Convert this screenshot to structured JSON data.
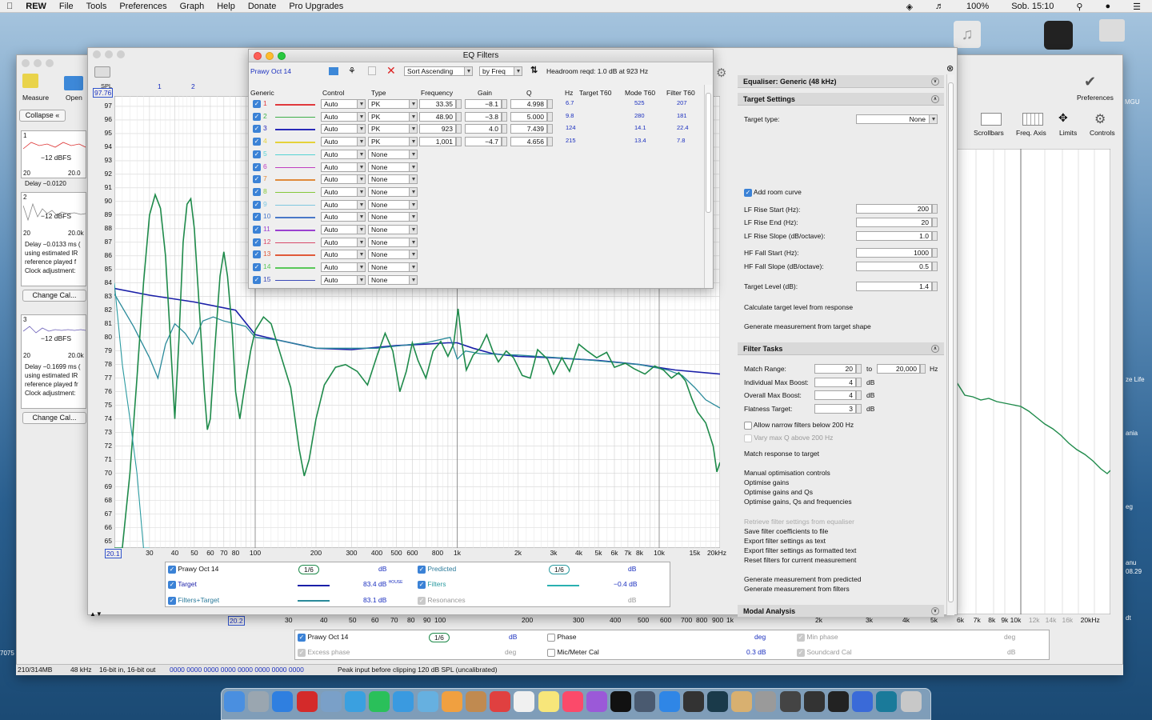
{
  "menubar": {
    "app": "REW",
    "items": [
      "File",
      "Tools",
      "Preferences",
      "Graph",
      "Help",
      "Donate",
      "Pro Upgrades"
    ],
    "battery": "100%",
    "clock": "Sob. 15:10"
  },
  "left_panel": {
    "tool_measure": "Measure",
    "tool_open": "Open",
    "collapse": "Collapse",
    "m1": {
      "num": "1",
      "level": "−12 dBFS",
      "x0": "20",
      "x1": "20.0",
      "delay": "Delay −0.0120"
    },
    "m2": {
      "num": "2",
      "level": "−12 dBFS",
      "x0": "20",
      "x1": "20.0k",
      "delay": "Delay −0.0133 ms (",
      "l2": "using estimated IR",
      "l3": "reference played f",
      "l4": "Clock adjustment:"
    },
    "m3": {
      "num": "3",
      "level": "−12 dBFS",
      "x0": "20",
      "x1": "20.0k",
      "delay": "Delay −0.1699 ms (",
      "l2": "using estimated IR",
      "l3": "reference played fr",
      "l4": "Clock adjustment:"
    },
    "change_cal": "Change Cal..."
  },
  "graph": {
    "y_unit": "SPL",
    "y_top": "97.76",
    "y_ticks": [
      "97",
      "96",
      "95",
      "94",
      "93",
      "92",
      "91",
      "90",
      "89",
      "88",
      "87",
      "86",
      "85",
      "84",
      "83",
      "82",
      "81",
      "80",
      "79",
      "78",
      "77",
      "76",
      "75",
      "74",
      "73",
      "72",
      "71",
      "70",
      "69",
      "68",
      "67",
      "66",
      "65"
    ],
    "x_start": "20.1",
    "x_ticks": [
      "30",
      "40",
      "50",
      "60",
      "70",
      "80",
      "100",
      "200",
      "300",
      "400",
      "500",
      "600",
      "800",
      "1k",
      "2k",
      "3k",
      "4k",
      "5k",
      "6k",
      "7k",
      "8k",
      "10k",
      "15k",
      "20kHz"
    ],
    "markers": [
      "1",
      "2"
    ]
  },
  "legend": {
    "r1": {
      "name": "Prawy Oct 14",
      "smooth": "1/6",
      "unit": "dB",
      "name2": "Predicted",
      "smooth2": "1/6",
      "unit2": "dB"
    },
    "r2": {
      "name": "Target",
      "val": "83.4 dB",
      "sup": "HOUSE",
      "name2": "Filters",
      "val2": "−0.4 dB"
    },
    "r3": {
      "name": "Filters+Target",
      "val": "83.1 dB",
      "name2": "Resonances",
      "unit2": "dB"
    }
  },
  "bottom_legend": {
    "name": "Prawy Oct 14",
    "smooth": "1/6",
    "unit": "dB",
    "phase": "Phase",
    "phase_unit": "deg",
    "min_phase": "Min phase",
    "min_unit": "deg",
    "excess": "Excess phase",
    "excess_unit": "deg",
    "mic": "Mic/Meter Cal",
    "mic_val": "0.3 dB",
    "sound": "Soundcard Cal",
    "sound_unit": "dB"
  },
  "bottom_axis": {
    "start": "20.2",
    "ticks": [
      "30",
      "40",
      "50",
      "60",
      "70",
      "80",
      "90",
      "100",
      "200",
      "300",
      "400",
      "500",
      "600",
      "700",
      "800",
      "900",
      "1k",
      "2k",
      "3k",
      "4k",
      "5k",
      "6k",
      "7k",
      "8k",
      "9k",
      "10k",
      "12k",
      "14k",
      "16k",
      "20kHz"
    ]
  },
  "status": {
    "mem": "210/314MB",
    "rate": "48 kHz",
    "bits": "16-bit in, 16-bit out",
    "meters": "0000 0000  0000 0000  0000 0000  0000 0000",
    "peak": "Peak input before clipping 120 dB SPL (uncalibrated)"
  },
  "eq_window": {
    "title": "EQ Filters",
    "measurement": "Prawy Oct 14",
    "sort": "Sort Ascending",
    "by": "by Freq",
    "headroom": "Headroom reqd:   1.0 dB at 923 Hz",
    "cols": {
      "generic": "Generic",
      "control": "Control",
      "type": "Type",
      "frequency": "Frequency",
      "gain": "Gain",
      "q": "Q",
      "hz": "Hz",
      "target_t60": "Target T60",
      "mode_t60": "Mode T60",
      "filter_t60": "Filter T60"
    },
    "filters": [
      {
        "n": "1",
        "color": "#e0393d",
        "control": "Auto",
        "type": "PK",
        "freq": "33.35",
        "gain": "−8.1",
        "q": "4.998"
      },
      {
        "n": "2",
        "color": "#3fb04a",
        "control": "Auto",
        "type": "PK",
        "freq": "48.90",
        "gain": "−3.8",
        "q": "5.000"
      },
      {
        "n": "3",
        "color": "#2a2ab8",
        "control": "Auto",
        "type": "PK",
        "freq": "923",
        "gain": "4.0",
        "q": "7.439"
      },
      {
        "n": "4",
        "color": "#e5d23a",
        "control": "Auto",
        "type": "PK",
        "freq": "1,001",
        "gain": "−4.7",
        "q": "4.656"
      },
      {
        "n": "5",
        "color": "#55d3d3",
        "control": "Auto",
        "type": "None"
      },
      {
        "n": "6",
        "color": "#c040c0",
        "control": "Auto",
        "type": "None"
      },
      {
        "n": "7",
        "color": "#e08a3a",
        "control": "Auto",
        "type": "None"
      },
      {
        "n": "8",
        "color": "#86c83a",
        "control": "Auto",
        "type": "None"
      },
      {
        "n": "9",
        "color": "#7ec7e0",
        "control": "Auto",
        "type": "None"
      },
      {
        "n": "10",
        "color": "#4a78c8",
        "control": "Auto",
        "type": "None"
      },
      {
        "n": "11",
        "color": "#9a40d0",
        "control": "Auto",
        "type": "None"
      },
      {
        "n": "12",
        "color": "#d84a6a",
        "control": "Auto",
        "type": "None"
      },
      {
        "n": "13",
        "color": "#e05a3a",
        "control": "Auto",
        "type": "None"
      },
      {
        "n": "14",
        "color": "#5ac85a",
        "control": "Auto",
        "type": "None"
      },
      {
        "n": "15",
        "color": "#3a4ab8",
        "control": "Auto",
        "type": "None"
      }
    ],
    "modes": [
      {
        "hz": "6.7",
        "mode": "525",
        "filt": "207"
      },
      {
        "hz": "9.8",
        "mode": "280",
        "filt": "181"
      },
      {
        "hz": "124",
        "mode": "14.1",
        "filt": "22.4"
      },
      {
        "hz": "215",
        "mode": "13.4",
        "filt": "7.8"
      }
    ]
  },
  "eq_panel": {
    "header": "Equaliser: Generic (48 kHz)",
    "target_settings": "Target Settings",
    "target_type_label": "Target type:",
    "target_type": "None",
    "add_room": "Add room curve",
    "lf_start_l": "LF Rise Start (Hz):",
    "lf_start": "200",
    "lf_end_l": "LF Rise End (Hz):",
    "lf_end": "20",
    "lf_slope_l": "LF Rise Slope (dB/octave):",
    "lf_slope": "1.0",
    "hf_start_l": "HF Fall Start (Hz):",
    "hf_start": "1000",
    "hf_slope_l": "HF Fall Slope (dB/octave):",
    "hf_slope": "0.5",
    "level_l": "Target Level (dB):",
    "level": "1.4",
    "calc": "Calculate target level from response",
    "gen_target": "Generate measurement from target shape",
    "filter_tasks": "Filter Tasks",
    "match_l": "Match Range:",
    "match_from": "20",
    "to": "to",
    "match_to": "20,000",
    "hz": "Hz",
    "ind_l": "Individual Max Boost:",
    "ind": "4",
    "db": "dB",
    "ovr_l": "Overall Max Boost:",
    "ovr": "4",
    "flat_l": "Flatness Target:",
    "flat": "3",
    "narrow": "Allow narrow filters below 200 Hz",
    "vary": "Vary max Q above 200 Hz",
    "match_resp": "Match response to target",
    "manual": "Manual optimisation controls",
    "opt1": "Optimise gains",
    "opt2": "Optimise gains and Qs",
    "opt3": "Optimise gains, Qs and frequencies",
    "retrieve": "Retrieve filter settings from equaliser",
    "save": "Save filter coefficients to file",
    "exp1": "Export filter settings as text",
    "exp2": "Export filter settings as formatted text",
    "reset": "Reset filters for current measurement",
    "gen_pred": "Generate measurement from predicted",
    "gen_filt": "Generate measurement from filters",
    "modal": "Modal Analysis"
  },
  "right_toolbar": {
    "prefs": "Preferences",
    "scrollbars": "Scrollbars",
    "freq_axis": "Freq. Axis",
    "limits": "Limits",
    "controls": "Controls"
  },
  "desktop": {
    "t1": "ze Life",
    "t2": "ania",
    "t3": "eg",
    "t4": "anu",
    "t5": "08.29",
    "t6": "dt",
    "t7": "MGU",
    "t8": "7075"
  }
}
